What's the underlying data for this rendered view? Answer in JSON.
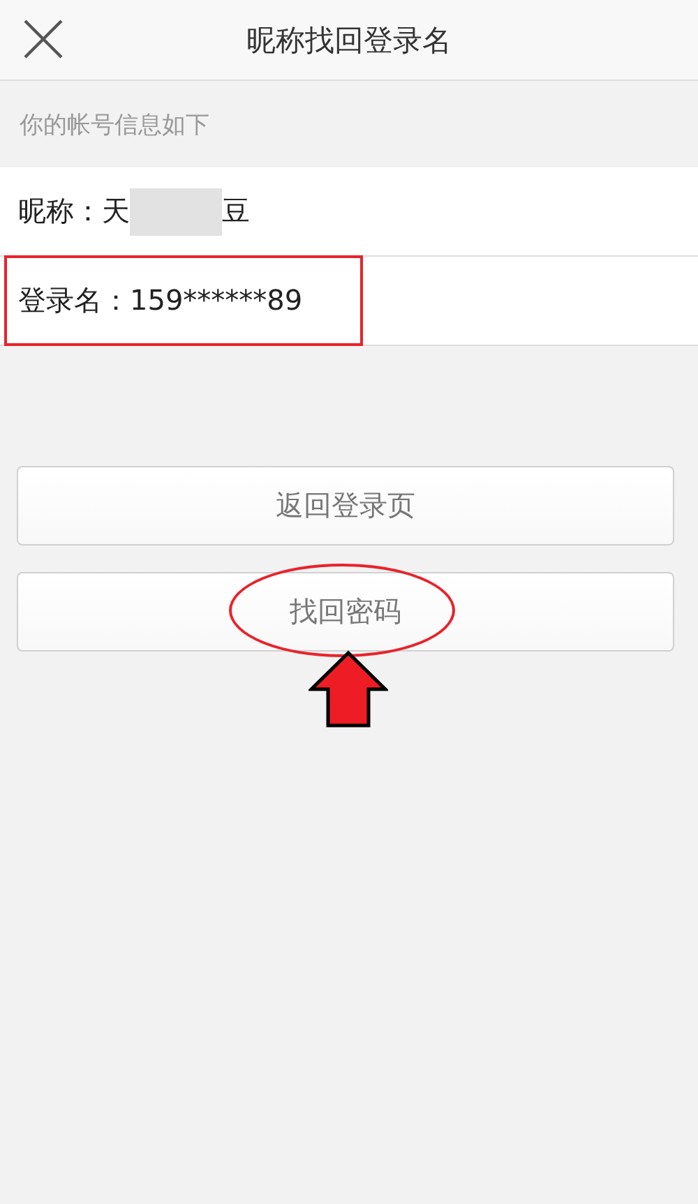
{
  "header": {
    "title": "昵称找回登录名"
  },
  "caption": "你的帐号信息如下",
  "rows": [
    {
      "text": "昵称：天",
      "redacted": true,
      "text_after": "豆",
      "highlighted": false
    },
    {
      "text": "登录名：159******89",
      "highlighted": true
    }
  ],
  "buttons": [
    {
      "label": "返回登录页",
      "circled": false,
      "arrow": false
    },
    {
      "label": "找回密码",
      "circled": true,
      "arrow": true
    }
  ]
}
